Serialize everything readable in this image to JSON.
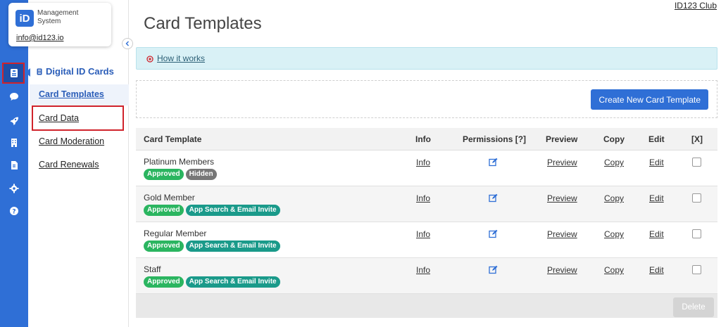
{
  "brand": {
    "logo": "iD",
    "name_line1": "Management",
    "name_line2": "System",
    "email": "info@id123.io"
  },
  "top_link": "ID123 Club",
  "page_title": "Card Templates",
  "info_bar": {
    "link": "How it works"
  },
  "create_button": "Create New Card Template",
  "sidebar": {
    "section_title": "Digital ID Cards",
    "items": [
      {
        "label": "Card Templates",
        "active": true
      },
      {
        "label": "Card Data"
      },
      {
        "label": "Card Moderation"
      },
      {
        "label": "Card Renewals"
      }
    ]
  },
  "rail_icons": [
    "id-card-icon",
    "chat-icon",
    "rocket-icon",
    "building-icon",
    "document-icon",
    "gear-icon",
    "help-icon"
  ],
  "table": {
    "columns": {
      "template": "Card Template",
      "info": "Info",
      "permissions": "Permissions [?]",
      "preview": "Preview",
      "copy": "Copy",
      "edit": "Edit",
      "x": "[X]"
    },
    "rows": [
      {
        "name": "Platinum Members",
        "badges": [
          {
            "text": "Approved",
            "color": "green"
          },
          {
            "text": "Hidden",
            "color": "grey"
          }
        ],
        "info": "Info",
        "preview": "Preview",
        "copy": "Copy",
        "edit": "Edit"
      },
      {
        "name": "Gold Member",
        "badges": [
          {
            "text": "Approved",
            "color": "green"
          },
          {
            "text": "App Search & Email Invite",
            "color": "teal"
          }
        ],
        "info": "Info",
        "preview": "Preview",
        "copy": "Copy",
        "edit": "Edit"
      },
      {
        "name": "Regular Member",
        "badges": [
          {
            "text": "Approved",
            "color": "green"
          },
          {
            "text": "App Search & Email Invite",
            "color": "teal"
          }
        ],
        "info": "Info",
        "preview": "Preview",
        "copy": "Copy",
        "edit": "Edit"
      },
      {
        "name": "Staff",
        "badges": [
          {
            "text": "Approved",
            "color": "green"
          },
          {
            "text": "App Search & Email Invite",
            "color": "teal"
          }
        ],
        "info": "Info",
        "preview": "Preview",
        "copy": "Copy",
        "edit": "Edit"
      }
    ],
    "delete_button": "Delete"
  },
  "colors": {
    "primary": "#2f6fd6",
    "highlight": "#d0232b",
    "approved": "#2bb560",
    "hidden": "#777777",
    "invite": "#1a9a8a",
    "info_bar": "#d9f1f6"
  }
}
